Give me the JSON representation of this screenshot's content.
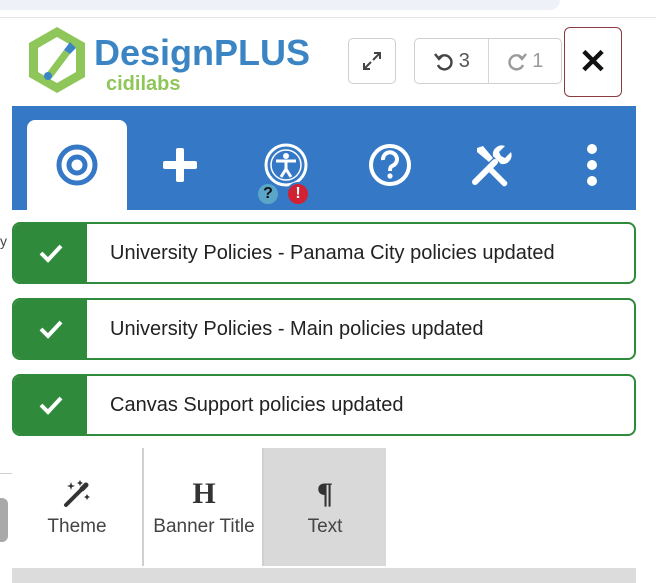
{
  "header": {
    "logo": {
      "brand": "DesignPLUS",
      "sub": "cidilabs"
    },
    "undo_count": "3",
    "redo_count": "1",
    "close_label": "✕"
  },
  "tabs": [
    {
      "name": "target",
      "active": true
    },
    {
      "name": "add",
      "active": false
    },
    {
      "name": "accessibility",
      "active": false,
      "badges": [
        "?",
        "!"
      ]
    },
    {
      "name": "help",
      "active": false
    },
    {
      "name": "tools",
      "active": false
    },
    {
      "name": "more",
      "active": false
    }
  ],
  "notices": [
    {
      "message": "University Policies - Panama City policies updated"
    },
    {
      "message": "University Policies - Main policies updated"
    },
    {
      "message": "Canvas Support policies updated"
    }
  ],
  "toolbar": {
    "theme_label": "Theme",
    "banner_label": "Banner Title",
    "banner_icon": "H",
    "text_label": "Text",
    "text_icon": "¶"
  },
  "colors": {
    "tab_bar": "#3478c6",
    "success": "#2f8a3c",
    "brand_blue": "#3b85c4",
    "brand_green": "#8fc65a"
  },
  "background_fragment": "y"
}
